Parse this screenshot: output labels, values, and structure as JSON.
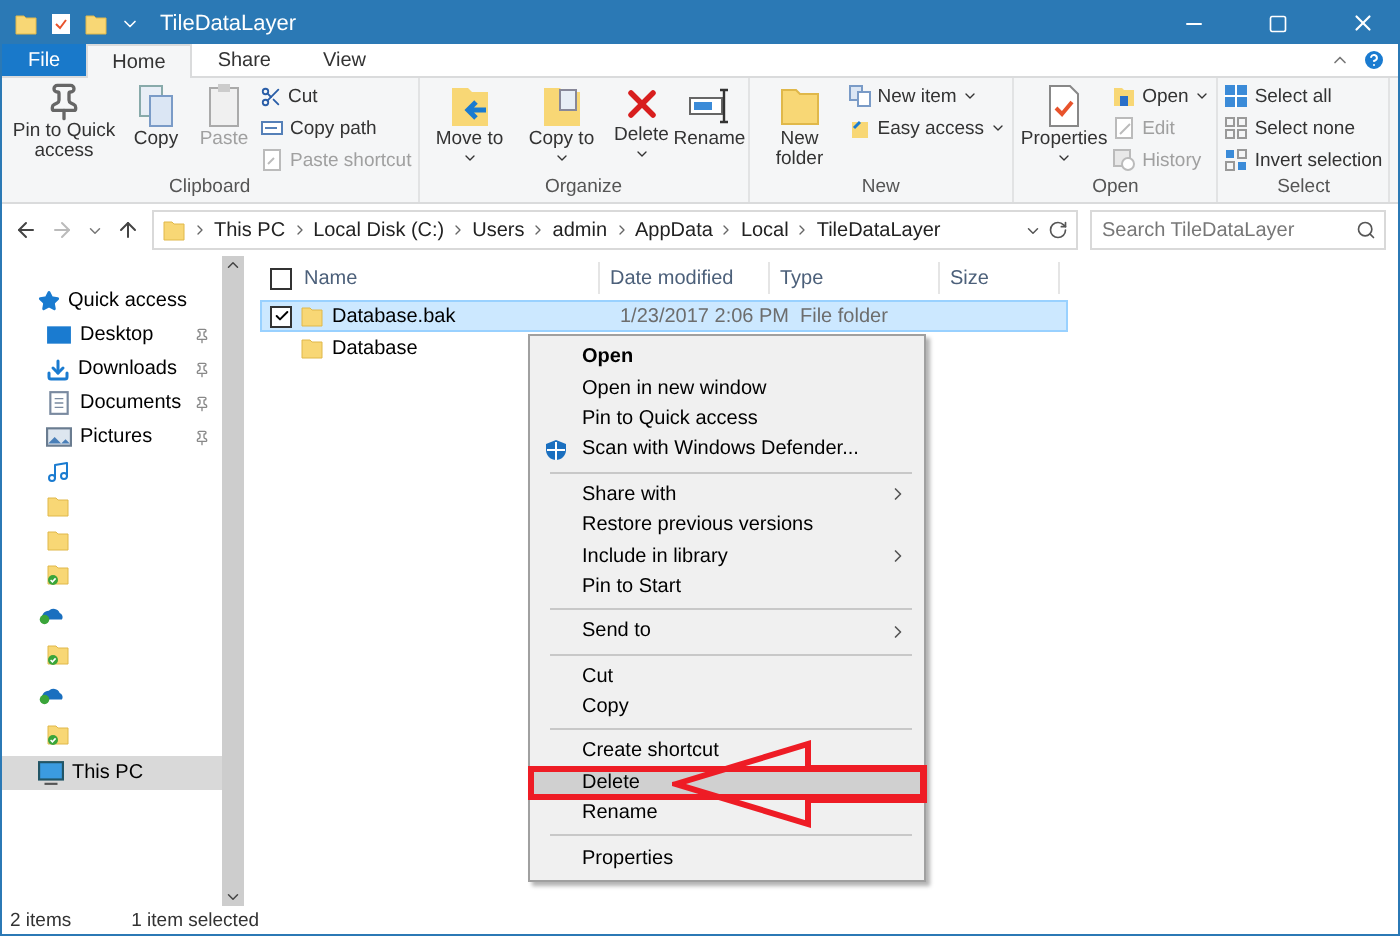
{
  "window": {
    "title": "TileDataLayer"
  },
  "ribbon_tabs": [
    {
      "label": "File",
      "kind": "file",
      "selected": false
    },
    {
      "label": "Home",
      "kind": "tab",
      "selected": true
    },
    {
      "label": "Share",
      "kind": "tab",
      "selected": false
    },
    {
      "label": "View",
      "kind": "tab",
      "selected": false
    }
  ],
  "ribbon_groups": [
    {
      "label": "Clipboard",
      "large": [
        {
          "label": "Pin to Quick access",
          "disabled": false,
          "dropdown": false
        },
        {
          "label": "Copy",
          "disabled": false,
          "dropdown": false
        },
        {
          "label": "Paste",
          "disabled": true,
          "dropdown": false
        }
      ],
      "small": [
        {
          "label": "Cut",
          "disabled": false,
          "dropdown": false
        },
        {
          "label": "Copy path",
          "disabled": false,
          "dropdown": false
        },
        {
          "label": "Paste shortcut",
          "disabled": true,
          "dropdown": false
        }
      ]
    },
    {
      "label": "Organize",
      "large": [
        {
          "label": "Move to",
          "disabled": false,
          "dropdown": true
        },
        {
          "label": "Copy to",
          "disabled": false,
          "dropdown": true
        },
        {
          "label": "Delete",
          "disabled": false,
          "dropdown": true
        },
        {
          "label": "Rename",
          "disabled": false,
          "dropdown": false
        }
      ]
    },
    {
      "label": "New",
      "large": [
        {
          "label": "New folder",
          "disabled": false,
          "dropdown": false
        }
      ],
      "small": [
        {
          "label": "New item",
          "disabled": false,
          "dropdown": true
        },
        {
          "label": "Easy access",
          "disabled": false,
          "dropdown": true
        }
      ]
    },
    {
      "label": "Open",
      "large": [
        {
          "label": "Properties",
          "disabled": false,
          "dropdown": true
        }
      ],
      "small": [
        {
          "label": "Open",
          "disabled": false,
          "dropdown": true
        },
        {
          "label": "Edit",
          "disabled": true,
          "dropdown": false
        },
        {
          "label": "History",
          "disabled": true,
          "dropdown": false
        }
      ]
    },
    {
      "label": "Select",
      "small": [
        {
          "label": "Select all",
          "disabled": false,
          "dropdown": false
        },
        {
          "label": "Select none",
          "disabled": false,
          "dropdown": false
        },
        {
          "label": "Invert selection",
          "disabled": false,
          "dropdown": false
        }
      ]
    }
  ],
  "address": {
    "crumbs": [
      "This PC",
      "Local Disk (C:)",
      "Users",
      "admin",
      "AppData",
      "Local",
      "TileDataLayer"
    ]
  },
  "search": {
    "placeholder": "Search TileDataLayer"
  },
  "sidebar": [
    {
      "label": "Quick access",
      "kind": "star",
      "pinned": false,
      "selected": false
    },
    {
      "label": "Desktop",
      "kind": "desktop",
      "pinned": true,
      "selected": false
    },
    {
      "label": "Downloads",
      "kind": "download",
      "pinned": true,
      "selected": false
    },
    {
      "label": "Documents",
      "kind": "document",
      "pinned": true,
      "selected": false
    },
    {
      "label": "Pictures",
      "kind": "picture",
      "pinned": true,
      "selected": false
    },
    {
      "kind": "music",
      "selected": false
    },
    {
      "kind": "folder",
      "selected": false
    },
    {
      "kind": "folder",
      "selected": false
    },
    {
      "kind": "synced",
      "selected": false
    },
    {
      "kind": "cloud",
      "selected": false
    },
    {
      "kind": "synced",
      "selected": false
    },
    {
      "kind": "cloud",
      "selected": false
    },
    {
      "kind": "synced",
      "selected": false
    },
    {
      "label": "This PC",
      "kind": "pc",
      "pinned": false,
      "selected": true
    }
  ],
  "table": {
    "select_all_checked": false,
    "columns": [
      "Name",
      "Date modified",
      "Type",
      "Size"
    ],
    "rows": [
      {
        "name": "Database.bak",
        "date": "1/23/2017 2:06 PM",
        "type": "File folder",
        "selected": true,
        "checked": true
      },
      {
        "name": "Database",
        "selected": false,
        "checked": false
      }
    ]
  },
  "context_menu": [
    {
      "kind": "item",
      "label": "Open",
      "bold": true,
      "submenu": false,
      "selected": false
    },
    {
      "kind": "item",
      "label": "Open in new window",
      "bold": false,
      "submenu": false,
      "selected": false
    },
    {
      "kind": "item",
      "label": "Pin to Quick access",
      "bold": false,
      "submenu": false,
      "selected": false
    },
    {
      "kind": "icon-item",
      "label": "Scan with Windows Defender...",
      "bold": false,
      "submenu": false,
      "selected": false
    },
    {
      "kind": "separator"
    },
    {
      "kind": "item",
      "label": "Share with",
      "bold": false,
      "submenu": true,
      "selected": false
    },
    {
      "kind": "item",
      "label": "Restore previous versions",
      "bold": false,
      "submenu": false,
      "selected": false
    },
    {
      "kind": "item",
      "label": "Include in library",
      "bold": false,
      "submenu": true,
      "selected": false
    },
    {
      "kind": "item",
      "label": "Pin to Start",
      "bold": false,
      "submenu": false,
      "selected": false
    },
    {
      "kind": "separator"
    },
    {
      "kind": "item",
      "label": "Send to",
      "bold": false,
      "submenu": true,
      "selected": false
    },
    {
      "kind": "separator"
    },
    {
      "kind": "item",
      "label": "Cut",
      "bold": false,
      "submenu": false,
      "selected": false
    },
    {
      "kind": "item",
      "label": "Copy",
      "bold": false,
      "submenu": false,
      "selected": false
    },
    {
      "kind": "separator"
    },
    {
      "kind": "item",
      "label": "Create shortcut",
      "bold": false,
      "submenu": false,
      "selected": false
    },
    {
      "kind": "item",
      "label": "Delete",
      "bold": false,
      "submenu": false,
      "selected": true,
      "annotated": true
    },
    {
      "kind": "item",
      "label": "Rename",
      "bold": false,
      "submenu": false,
      "selected": false
    },
    {
      "kind": "separator"
    },
    {
      "kind": "item",
      "label": "Properties",
      "bold": false,
      "submenu": false,
      "selected": false
    }
  ],
  "status_bar": [
    "2 items",
    "1 item selected"
  ]
}
